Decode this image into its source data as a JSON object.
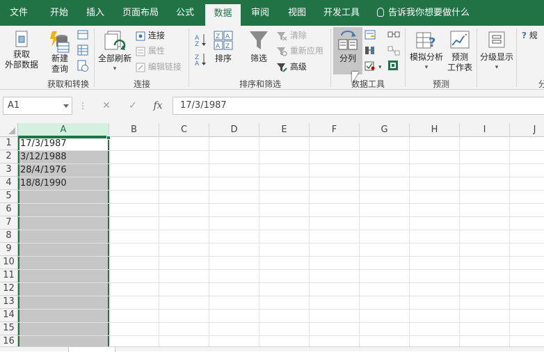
{
  "tabs": [
    {
      "label": "文件",
      "active": false
    },
    {
      "label": "开始",
      "active": false
    },
    {
      "label": "插入",
      "active": false
    },
    {
      "label": "页面布局",
      "active": false
    },
    {
      "label": "公式",
      "active": false
    },
    {
      "label": "数据",
      "active": true
    },
    {
      "label": "审阅",
      "active": false
    },
    {
      "label": "视图",
      "active": false
    },
    {
      "label": "开发工具",
      "active": false
    }
  ],
  "tell_me": "告诉我你想要做什么",
  "ribbon": {
    "get_transform": {
      "get_external_line1": "获取",
      "get_external_line2": "外部数据",
      "new_query_line1": "新建",
      "new_query_line2": "查询",
      "group_label": "获取和转换"
    },
    "connections": {
      "refresh_all": "全部刷新",
      "connections": "连接",
      "properties": "属性",
      "edit_links": "编辑链接",
      "group_label": "连接"
    },
    "sort_filter": {
      "sort": "排序",
      "filter": "筛选",
      "clear": "清除",
      "reapply": "重新应用",
      "advanced": "高级",
      "group_label": "排序和筛选"
    },
    "data_tools": {
      "text_to_columns": "分列",
      "group_label": "数据工具"
    },
    "forecast": {
      "what_if_line1": "模拟分析",
      "forecast_sheet_line1": "预测",
      "forecast_sheet_line2": "工作表",
      "group_label": "预测"
    },
    "outline": {
      "label": "分级显示",
      "group_label_partial": "分"
    },
    "help_partial": "规"
  },
  "formula_bar": {
    "name_box": "A1",
    "cancel": "✕",
    "enter": "✓",
    "fx": "fx",
    "value": "17/3/1987"
  },
  "columns": [
    "A",
    "B",
    "C",
    "D",
    "E",
    "F",
    "G",
    "H",
    "I",
    "J"
  ],
  "rows": [
    "1",
    "2",
    "3",
    "4",
    "5",
    "6",
    "7",
    "8",
    "9",
    "10",
    "11",
    "12",
    "13",
    "14",
    "15",
    "16"
  ],
  "cells": {
    "A1": "17/3/1987",
    "A2": "3/12/1988",
    "A3": "28/4/1976",
    "A4": "18/8/1990"
  },
  "colors": {
    "accent": "#217346",
    "selection": "#c6c6c6"
  }
}
